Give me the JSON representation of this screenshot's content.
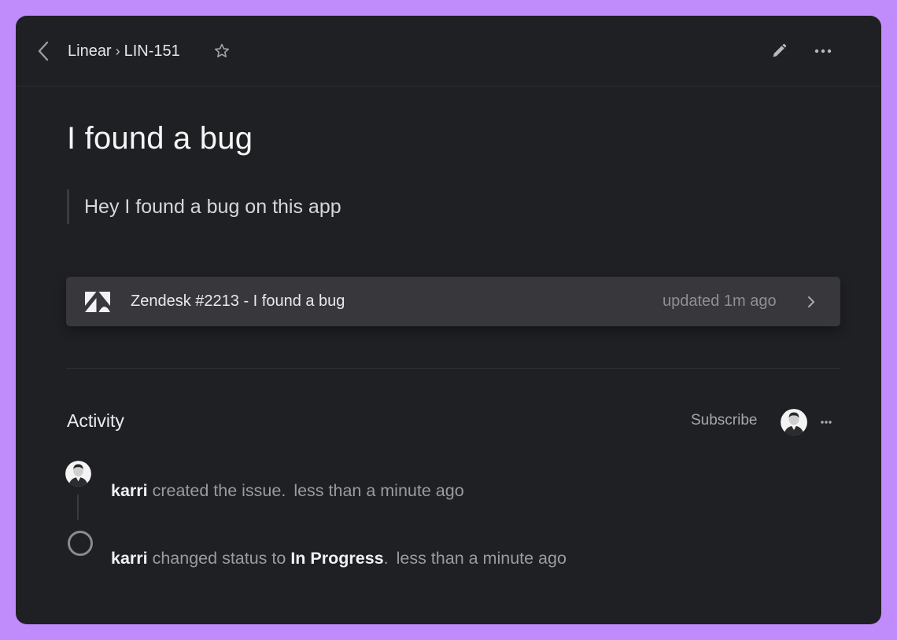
{
  "header": {
    "workspace": "Linear",
    "separator": "›",
    "issue_id": "LIN-151"
  },
  "issue": {
    "title": "I found a bug",
    "description": "Hey I found a bug on this app"
  },
  "attachment": {
    "title": "Zendesk #2213 - I found a bug",
    "updated": "updated 1m ago",
    "icon": "zendesk-logo"
  },
  "activity": {
    "heading": "Activity",
    "subscribe_label": "Subscribe",
    "events": [
      {
        "user": "karri",
        "action": " created the issue.",
        "time": "less than a minute ago"
      },
      {
        "user": "karri",
        "action": " changed status to ",
        "status": "In Progress",
        "suffix": ".",
        "time": "less than a minute ago"
      }
    ]
  },
  "icons": {
    "back": "chevron-left-icon",
    "star": "star-icon",
    "edit": "pencil-icon",
    "more": "ellipsis-icon",
    "chevron": "chevron-right-icon"
  },
  "colors": {
    "background": "#c08cfb",
    "window": "#1f2023",
    "card": "#37373c",
    "text_primary": "#f5f5f6",
    "text_muted": "#9b9ba1"
  }
}
